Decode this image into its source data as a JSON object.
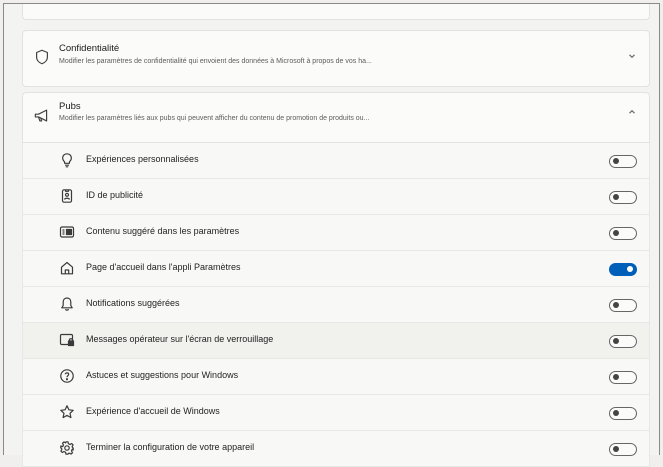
{
  "sections": {
    "privacy": {
      "title": "Confidentialité",
      "subtitle": "Modifier les paramètres de confidentialité qui envoient des données à Microsoft à propos de vos ha...",
      "icon": "shield-icon",
      "expanded": false
    },
    "pubs": {
      "title": "Pubs",
      "subtitle": "Modifier les paramètres liés aux pubs qui peuvent afficher du contenu de promotion de produits ou...",
      "icon": "megaphone-icon",
      "expanded": true
    }
  },
  "settings": [
    {
      "label": "Expériences personnalisées",
      "icon": "lightbulb-icon",
      "on": false
    },
    {
      "label": "ID de publicité",
      "icon": "id-badge-icon",
      "on": false
    },
    {
      "label": "Contenu suggéré dans les paramètres",
      "icon": "suggested-content-icon",
      "on": false
    },
    {
      "label": "Page d'accueil dans l'appli Paramètres",
      "icon": "home-icon",
      "on": true
    },
    {
      "label": "Notifications suggérées",
      "icon": "bell-icon",
      "on": false
    },
    {
      "label": "Messages opérateur sur l'écran de verrouillage",
      "icon": "lock-screen-icon",
      "on": false
    },
    {
      "label": "Astuces et suggestions pour Windows",
      "icon": "help-circle-icon",
      "on": false
    },
    {
      "label": "Expérience d'accueil de Windows",
      "icon": "star-icon",
      "on": false
    },
    {
      "label": "Terminer la configuration de votre appareil",
      "icon": "gear-icon",
      "on": false
    }
  ],
  "colors": {
    "accent": "#005fb8"
  }
}
